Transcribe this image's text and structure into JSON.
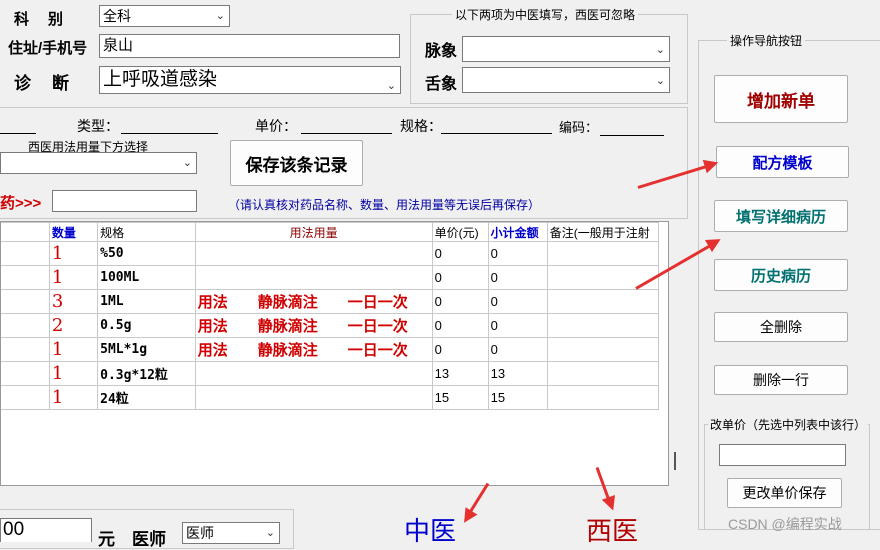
{
  "top": {
    "dept_label": "科　别",
    "dept_value": "全科",
    "address_label": "住址/手机号",
    "address_value": "泉山",
    "diagnosis_label": "诊　断",
    "diagnosis_value": "上呼吸道感染"
  },
  "tcm": {
    "note": "以下两项为中医填写，西医可忽略",
    "pulse_label": "脉象",
    "pulse_value": "",
    "tongue_label": "舌象",
    "tongue_value": ""
  },
  "drug_form": {
    "type_label": "类型：",
    "price_label": "单价：",
    "spec_label": "规格：",
    "code_label": "编码：",
    "usage_note": "西医用法用量下方选择",
    "save_button": "保存该条记录",
    "drug_prompt": "药>>>",
    "verify_note": "（请认真核对药品名称、数量、用法用量等无误后再保存）"
  },
  "table": {
    "headers": [
      "数量",
      "规格",
      "用法用量",
      "单价(元)",
      "小计金额",
      "备注(一般用于注射"
    ],
    "rows": [
      {
        "qty": "1",
        "spec": "%50",
        "usage": "",
        "price": "0",
        "subtotal": "0"
      },
      {
        "qty": "1",
        "spec": "100ML",
        "usage": "",
        "price": "0",
        "subtotal": "0"
      },
      {
        "qty": "3",
        "spec": "1ML",
        "usage": "用法　　静脉滴注　　一日一次",
        "price": "0",
        "subtotal": "0"
      },
      {
        "qty": "2",
        "spec": "0.5g",
        "usage": "用法　　静脉滴注　　一日一次",
        "price": "0",
        "subtotal": "0"
      },
      {
        "qty": "1",
        "spec": "5ML*1g",
        "usage": "用法　　静脉滴注　　一日一次",
        "price": "0",
        "subtotal": "0"
      },
      {
        "qty": "1",
        "spec": "0.3g*12粒",
        "usage": "",
        "price": "13",
        "subtotal": "13"
      },
      {
        "qty": "1",
        "spec": "24粒",
        "usage": "",
        "price": "15",
        "subtotal": "15"
      }
    ]
  },
  "bottom": {
    "total_value": "00",
    "yuan_label": "元",
    "doctor_label": "医师",
    "doctor_value": "医师",
    "tcm_label": "中医",
    "wm_label": "西医"
  },
  "nav": {
    "title": "操作导航按钮",
    "add_new": "增加新单",
    "template": "配方模板",
    "fill_record": "填写详细病历",
    "history": "历史病历",
    "delete_all": "全删除",
    "delete_row": "删除一行",
    "price_title": "改单价（先选中列表中该行）",
    "price_value": "",
    "save_price": "更改单价保存"
  },
  "watermark": "CSDN @编程实战",
  "colors": {
    "red": "#d00000",
    "blue": "#0000cc",
    "teal": "#007070",
    "dark_red": "#8b0000",
    "arrow": "#e53030"
  }
}
